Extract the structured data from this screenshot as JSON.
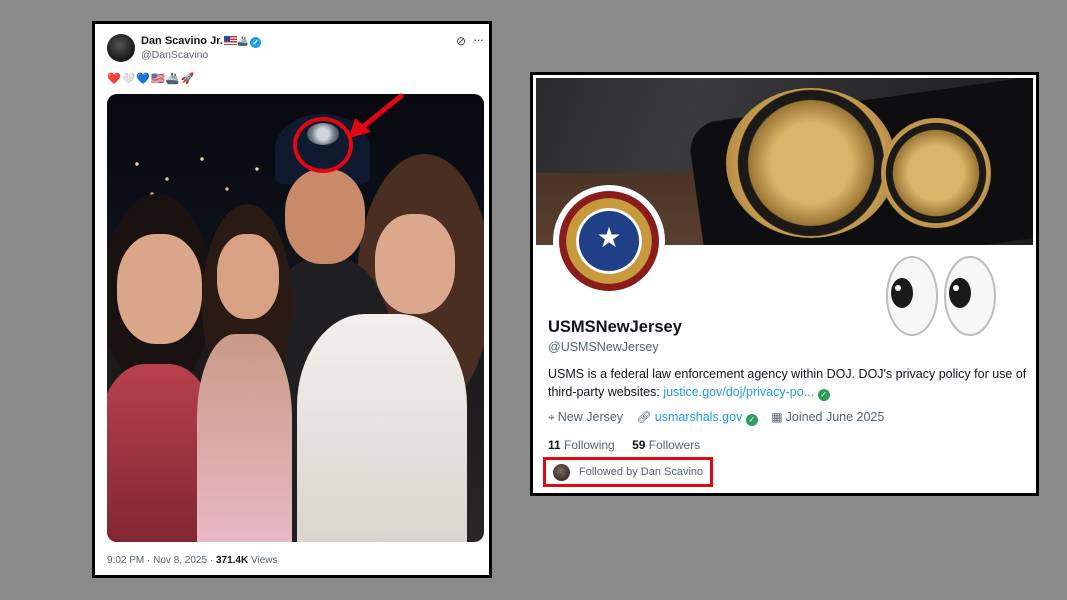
{
  "tweet": {
    "author_name": "Dan Scavino Jr.",
    "author_handle": "@DanScavino",
    "emoji_line": "❤️🤍💙🇺🇸🚢🚀",
    "timestamp": "9:02 PM · Nov 8, 2025 · ",
    "views_count": "371.4K",
    "views_label": " Views"
  },
  "profile": {
    "display_name": "USMSNewJersey",
    "handle": "@USMSNewJersey",
    "bio_text": "USMS is a federal law enforcement agency within DOJ. DOJ's privacy policy for use of third-party websites: ",
    "bio_link": "justice.gov/doj/privacy-po...",
    "location": "New Jersey",
    "website": "usmarshals.gov",
    "joined": "Joined June 2025",
    "following_count": "11",
    "following_label": "Following",
    "followers_count": "59",
    "followers_label": "Followers",
    "followed_by": "Followed by Dan Scavino"
  },
  "colors": {
    "highlight": "#e30613",
    "link": "#1d9bf0",
    "verified_gov": "#2e9c5a"
  },
  "icons": [
    "verified-badge-icon",
    "grok-icon",
    "more-icon",
    "location-icon",
    "link-icon",
    "calendar-icon",
    "eyes-emoji-icon",
    "red-arrow-icon"
  ]
}
